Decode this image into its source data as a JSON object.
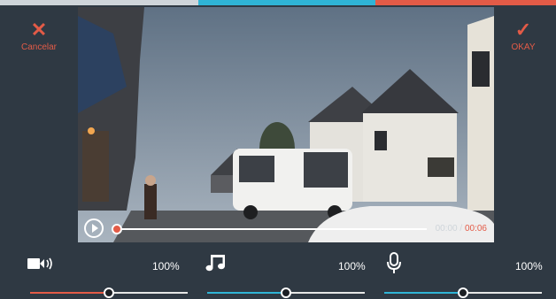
{
  "colors": {
    "background": "#2f3943",
    "accent_red": "#e35b47",
    "accent_blue": "#2fb4d6",
    "strip_gray": "#cfd5da"
  },
  "header": {
    "cancel_label": "Cancelar",
    "okay_label": "OKAY"
  },
  "player": {
    "time_current": "00:00",
    "time_separator": " / ",
    "time_end": "00:06",
    "progress": 0.0
  },
  "mixer": {
    "video": {
      "icon": "video-camera-icon",
      "percent_label": "100%",
      "level": 0.48
    },
    "music": {
      "icon": "music-note-icon",
      "percent_label": "100%",
      "level": 0.5
    },
    "voice": {
      "icon": "microphone-icon",
      "percent_label": "100%",
      "level": 0.5
    }
  }
}
